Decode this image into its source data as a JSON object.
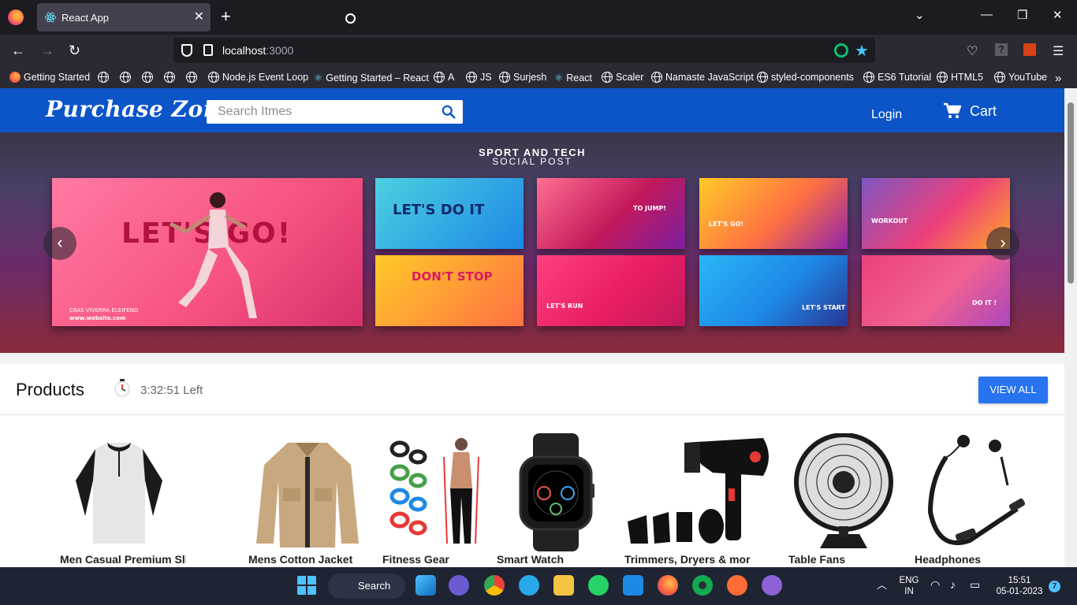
{
  "browser": {
    "tab_title": "React App",
    "url_host": "localhost",
    "url_port": ":3000",
    "bookmarks": [
      "Getting Started",
      "Node.js Event Loop",
      "Getting Started – React",
      "A",
      "JS",
      "Surjesh",
      "React",
      "Scaler",
      "Namaste JavaScript",
      "styled-components",
      "ES6 Tutorial",
      "HTML5",
      "YouTube"
    ]
  },
  "header": {
    "logo": "Purchase Zone",
    "search_placeholder": "Search Itmes",
    "login": "Login",
    "cart": "Cart"
  },
  "banner": {
    "title": "SPORT AND TECH",
    "subtitle": "SOCIAL POST",
    "cards": [
      "LET'S GO!",
      "LET'S DO IT",
      "TO JUMP!",
      "LET'S GO!",
      "WORKOUT",
      "DON'T STOP",
      "LET'S RUN",
      "LET'S START",
      "DO IT !"
    ],
    "main_footer": "CRAS VIVERRA ELEIFEND",
    "main_url": "www.website.com"
  },
  "products": {
    "title": "Products",
    "timer": "3:32:51 Left",
    "view_all": "VIEW ALL",
    "items": [
      {
        "name": "Men Casual Premium Slim Fit T-Shirts"
      },
      {
        "name": "Mens Cotton Jacket"
      },
      {
        "name": "Fitness Gear"
      },
      {
        "name": "Smart Watch"
      },
      {
        "name": "Trimmers, Dryers & more"
      },
      {
        "name": "Table Fans"
      },
      {
        "name": "Headphones"
      }
    ]
  },
  "taskbar": {
    "search": "Search",
    "lang_top": "ENG",
    "lang_bottom": "IN",
    "time": "15:51",
    "date": "05-01-2023",
    "notifications": "7"
  },
  "colors": {
    "brand_blue": "#0b55c9",
    "button_blue": "#2874f0"
  }
}
